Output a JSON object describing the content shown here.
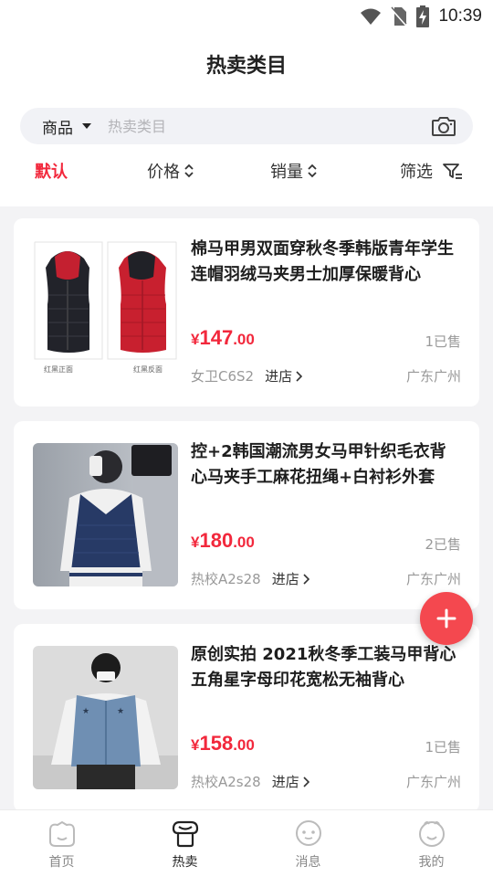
{
  "status_bar": {
    "time": "10:39"
  },
  "page": {
    "title": "热卖类目"
  },
  "search": {
    "scope": "商品",
    "placeholder": "热卖类目"
  },
  "filters": {
    "default": "默认",
    "price": "价格",
    "sales": "销量",
    "filter": "筛选"
  },
  "products": [
    {
      "title": "棉马甲男双面穿秋冬季韩版青年学生连帽羽绒马夹男士加厚保暖背心",
      "price_symbol": "¥",
      "price_int": "147",
      "price_dec": ".00",
      "sold": "1已售",
      "shop": "女卫C6S2",
      "enter": "进店",
      "location": "广东广州",
      "image_captions": [
        "红黑正面",
        "红黑反面"
      ]
    },
    {
      "title": "控+2韩国潮流男女马甲针织毛衣背心马夹手工麻花扭绳+白衬衫外套",
      "price_symbol": "¥",
      "price_int": "180",
      "price_dec": ".00",
      "sold": "2已售",
      "shop": "热校A2s28",
      "enter": "进店",
      "location": "广东广州",
      "image_captions": []
    },
    {
      "title": "原创实拍 2021秋冬季工装马甲背心五角星字母印花宽松无袖背心",
      "price_symbol": "¥",
      "price_int": "158",
      "price_dec": ".00",
      "sold": "1已售",
      "shop": "热校A2s28",
      "enter": "进店",
      "location": "广东广州",
      "image_captions": []
    }
  ],
  "tabs": [
    {
      "label": "首页",
      "icon": "home-icon"
    },
    {
      "label": "热卖",
      "icon": "hot-sale-icon",
      "active": true
    },
    {
      "label": "消息",
      "icon": "message-icon"
    },
    {
      "label": "我的",
      "icon": "profile-icon"
    }
  ],
  "colors": {
    "accent": "#f2283c",
    "fab": "#f4484f"
  }
}
